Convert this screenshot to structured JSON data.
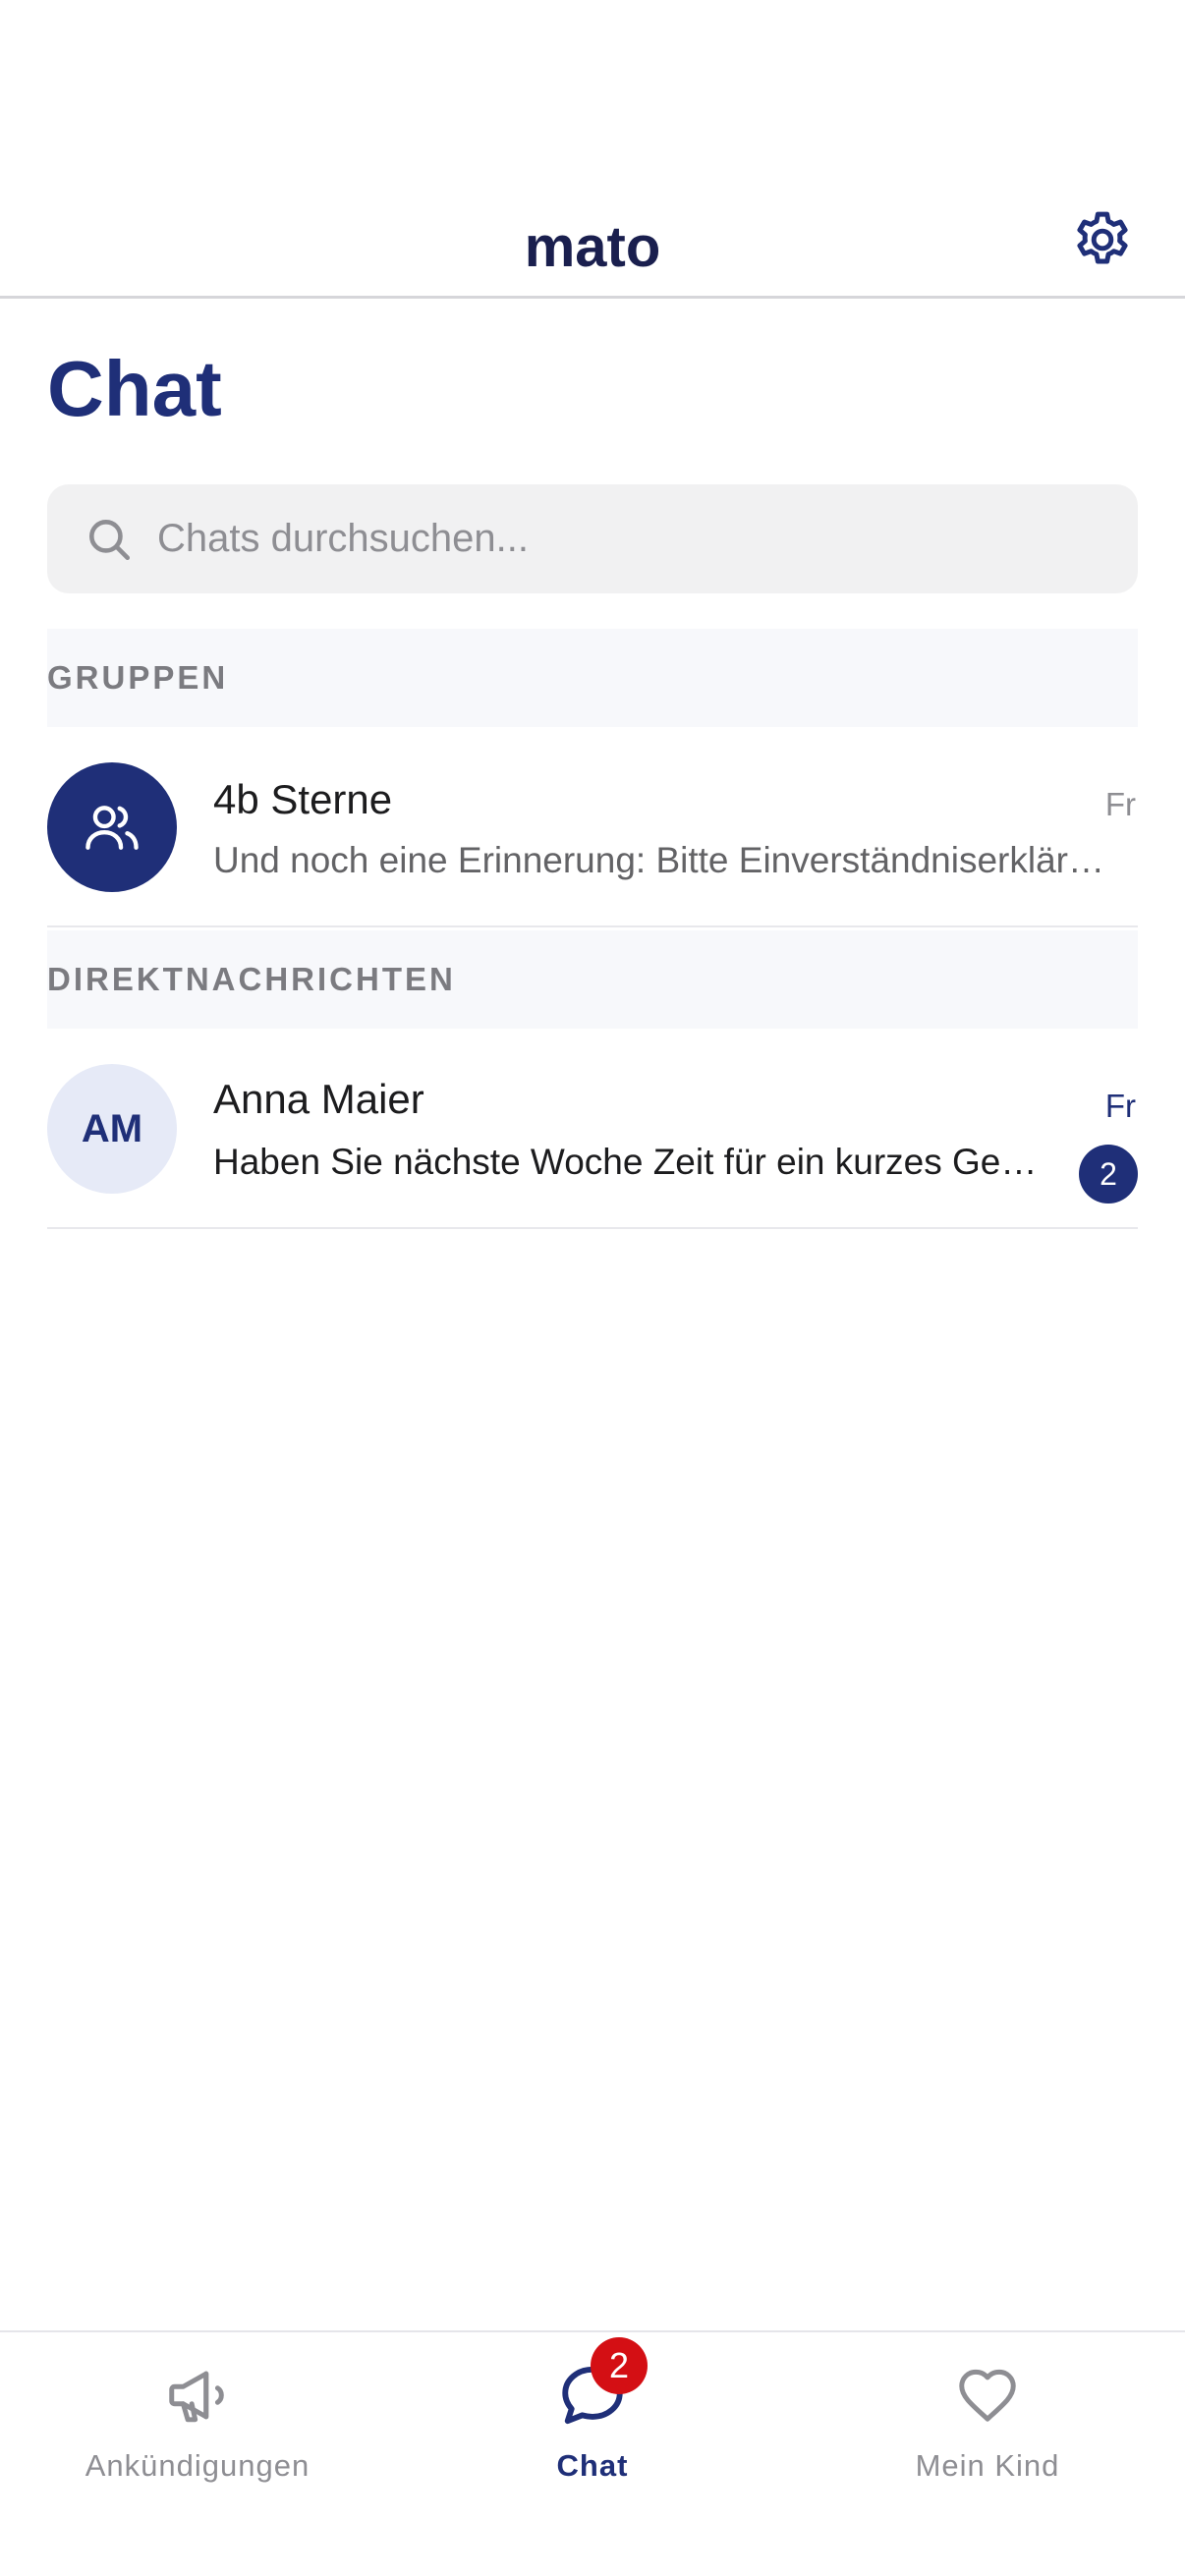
{
  "header": {
    "logo": "mato"
  },
  "page_title": "Chat",
  "search": {
    "placeholder": "Chats durchsuchen..."
  },
  "sections": [
    {
      "title": "GRUPPEN",
      "chats": [
        {
          "name": "4b Sterne",
          "preview": "Und noch eine Erinnerung: Bitte Einverständniserklärung",
          "time": "Fr",
          "avatar_icon": "group-icon",
          "unread": false
        }
      ]
    },
    {
      "title": "DIREKTNACHRICHTEN",
      "chats": [
        {
          "name": "Anna Maier",
          "preview": "Haben Sie nächste Woche Zeit für ein kurzes Gespräch?",
          "time": "Fr",
          "avatar_initials": "AM",
          "unread": true,
          "unread_count": "2"
        }
      ]
    }
  ],
  "tabbar": {
    "tabs": [
      {
        "label": "Ankündigungen",
        "icon": "megaphone-icon",
        "active": false
      },
      {
        "label": "Chat",
        "icon": "chat-bubble-icon",
        "active": true,
        "badge": "2"
      },
      {
        "label": "Mein Kind",
        "icon": "heart-icon",
        "active": false
      }
    ]
  },
  "colors": {
    "primary": "#1f2f78",
    "badge_red": "#d40f14",
    "logo": "#1a1f4e"
  }
}
